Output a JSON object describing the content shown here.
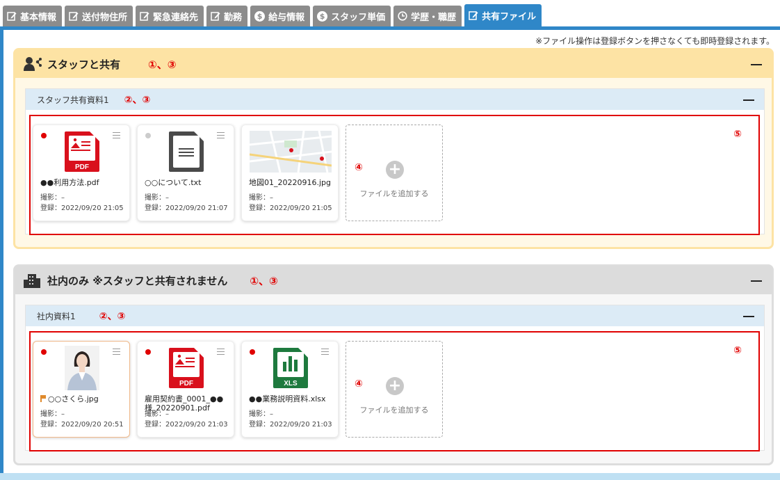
{
  "tabs": [
    {
      "label": "基本情報",
      "icon": "edit-icon"
    },
    {
      "label": "送付物住所",
      "icon": "edit-icon"
    },
    {
      "label": "緊急連絡先",
      "icon": "edit-icon"
    },
    {
      "label": "勤務",
      "icon": "edit-icon"
    },
    {
      "label": "給与情報",
      "icon": "dollar-icon"
    },
    {
      "label": "スタッフ単価",
      "icon": "dollar-icon"
    },
    {
      "label": "学歴・職歴",
      "icon": "clock-icon"
    },
    {
      "label": "共有ファイル",
      "icon": "edit-icon",
      "active": true
    }
  ],
  "notice": "※ファイル操作は登録ボタンを押さなくても即時登録されます。",
  "shared": {
    "title": "スタッフと共有",
    "mark": "①、③",
    "sub_title": "スタッフ共有資料1",
    "sub_mark": "②、③",
    "area_mark": "⑤",
    "add_mark": "④",
    "add_label": "ファイルを追加する",
    "files": [
      {
        "name": "●●利用方法.pdf",
        "shot": "撮影：–",
        "reg": "登録：2022/09/20 21:05",
        "type": "pdf",
        "dot": "red"
      },
      {
        "name": "○○について.txt",
        "shot": "撮影：–",
        "reg": "登録：2022/09/20 21:07",
        "type": "txt",
        "dot": "gray"
      },
      {
        "name": "地図01_20220916.jpg",
        "shot": "撮影：–",
        "reg": "登録：2022/09/20 21:05",
        "type": "map",
        "dot": "gray"
      }
    ]
  },
  "internal": {
    "title": "社内のみ ※スタッフと共有されません",
    "mark": "①、③",
    "sub_title": "社内資料1",
    "sub_mark": "②、③",
    "area_mark": "⑤",
    "add_mark": "④",
    "add_label": "ファイルを追加する",
    "files": [
      {
        "name": "○○さくら.jpg",
        "shot": "撮影：–",
        "reg": "登録：2022/09/20 20:51",
        "type": "photo",
        "dot": "red"
      },
      {
        "name": "雇用契約書_0001_●●様_20220901.pdf",
        "shot": "撮影：–",
        "reg": "登録：2022/09/20 21:03",
        "type": "pdf",
        "dot": "red"
      },
      {
        "name": "●●業務説明資料.xlsx",
        "shot": "撮影：–",
        "reg": "登録：2022/09/20 21:03",
        "type": "xls",
        "dot": "red"
      }
    ]
  },
  "labels": {
    "pdf": "PDF",
    "xls": "XLS"
  },
  "colors": {
    "tab_active": "#2f87c8",
    "tab_inactive": "#8c8c8c",
    "accent_red": "#e00000",
    "shared_header": "#fde3a4",
    "internal_header": "#dcdcdc",
    "pdf_red": "#d9101c",
    "xls_green": "#1e7a3e",
    "txt_gray": "#4a4a4a"
  }
}
